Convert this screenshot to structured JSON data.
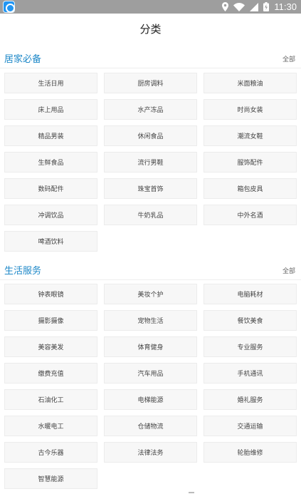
{
  "status_bar": {
    "time": "11:30"
  },
  "page": {
    "title": "分类"
  },
  "sections": [
    {
      "title": "居家必备",
      "all_label": "全部",
      "items": [
        "生活日用",
        "厨房调料",
        "米面粮油",
        "床上用品",
        "水产冻品",
        "时尚女装",
        "精品男装",
        "休闲食品",
        "潮流女鞋",
        "生鲜食品",
        "流行男鞋",
        "服饰配件",
        "数码配件",
        "珠宝首饰",
        "箱包皮具",
        "冲调饮品",
        "牛奶乳品",
        "中外名酒",
        "啤酒饮料"
      ]
    },
    {
      "title": "生活服务",
      "all_label": "全部",
      "items": [
        "钟表眼镜",
        "美妆个护",
        "电脑耗材",
        "摄影摄像",
        "宠物生活",
        "餐饮美食",
        "美容美发",
        "体育健身",
        "专业服务",
        "缴费充值",
        "汽车用品",
        "手机通讯",
        "石油化工",
        "电梯能源",
        "婚礼服务",
        "水暖电工",
        "仓储物流",
        "交通运输",
        "古今乐器",
        "法律法务",
        "轮胎维修",
        "智慧能源"
      ]
    }
  ]
}
